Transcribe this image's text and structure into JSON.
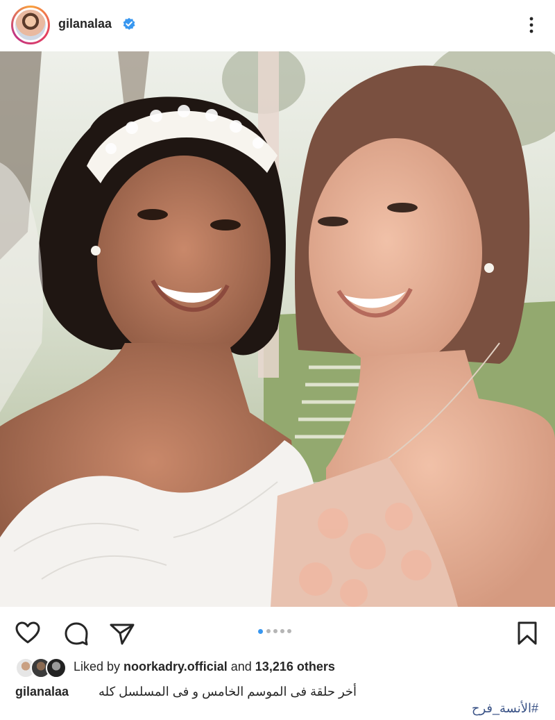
{
  "post": {
    "username": "gilanalaa",
    "verified": true,
    "icons": {
      "more": "more-vertical-icon",
      "like": "heart-icon",
      "comment": "comment-icon",
      "share": "send-icon",
      "save": "bookmark-icon",
      "verified": "verified-badge-icon"
    },
    "carousel": {
      "current_index": 1,
      "total": 5
    },
    "likes": {
      "prefix": "Liked by ",
      "user": "noorkadry.official",
      "middle": " and ",
      "count": "13,216 others"
    },
    "caption": {
      "username": "gilanalaa",
      "text": "أخر حلقة فى الموسم الخامس و فى المسلسل كله",
      "hashtag": "#الأنسة_فرح"
    }
  },
  "colors": {
    "text": "#262626",
    "verified_blue": "#3897f0",
    "hashtag": "#385185",
    "dot_inactive": "#b5b5b5"
  }
}
